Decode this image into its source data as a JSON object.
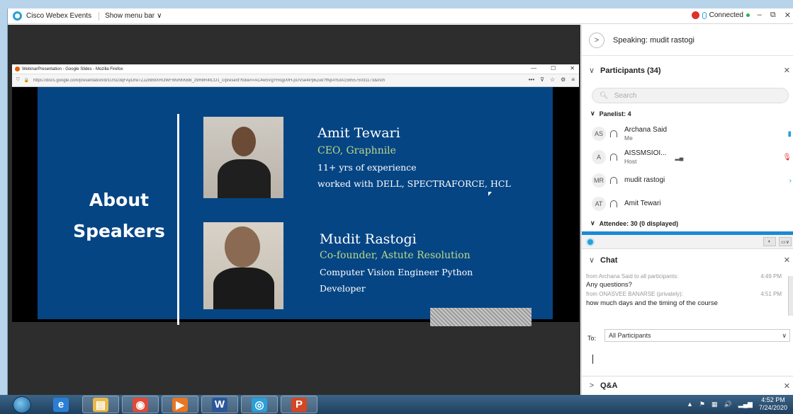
{
  "titlebar": {
    "app_title": "Cisco Webex Events",
    "menu_toggle": "Show menu bar",
    "menu_chevron": "∨",
    "status": "Connected",
    "minimize": "–",
    "restore": "⧉",
    "close": "✕"
  },
  "browser": {
    "tab_title": "WebinarPresentation - Google Slides - Mozilla Firefox",
    "minimize": "—",
    "restore": "☐",
    "close": "✕",
    "url": "https://docs.google.com/presentation/d/1USD3qFAyDrw7ZJZBB9XROWFWvhKKBB_z9R8R4tCO1_c/present?token=AC4w5VgYRogiXfH-pUVse4Pp6Zuk?fNjIA%3A1595575031173&inch",
    "more": "•••",
    "pocket": "⊽",
    "star": "☆",
    "ext": "⚙",
    "menu": "≡"
  },
  "slide": {
    "heading": "About Speakers",
    "speaker1": {
      "name": "Amit Tewari",
      "role": "CEO, Graphnile",
      "line1": "11+ yrs of experience",
      "line2": "worked with DELL, SPECTRAFORCE, HCL"
    },
    "speaker2": {
      "name": "Mudit Rastogi",
      "role": "Co-founder, Astute Resolution",
      "line1": "Computer Vision Engineer Python",
      "line2": "Developer"
    }
  },
  "panel": {
    "speaking_btn": ">",
    "speaking": "Speaking: mudit rastogi",
    "participants_head": "Participants (34)",
    "collapse_chev": "∨",
    "close": "✕",
    "search_placeholder": "Search",
    "panelists_head": "Panelist: 4",
    "participants": [
      {
        "initials": "AS",
        "name": "Archana Said",
        "role": "Me",
        "mark": "▮"
      },
      {
        "initials": "A",
        "name": "AISSMSIOI...",
        "role": "Host",
        "mark": "🎙"
      },
      {
        "initials": "MR",
        "name": "mudit rastogi",
        "role": "",
        "mark": "›"
      },
      {
        "initials": "AT",
        "name": "Amit Tewari",
        "role": "",
        "mark": ""
      }
    ],
    "attendee_head": "Attendee: 30 (0 displayed)",
    "tool_btn1": "◐",
    "tool_btn2": "▭∨",
    "chat_head": "Chat",
    "chat": [
      {
        "meta": "from Archana Said to all participants:",
        "time": "4:49 PM",
        "msg": "Any questions?"
      },
      {
        "meta": "from ONASVEE BANARSE (privately):",
        "time": "4:51 PM",
        "msg": "how much days and the timing of the course"
      }
    ],
    "to_label": "To:",
    "to_value": "All Participants",
    "to_chev": "∨",
    "qa_chev": ">",
    "qa_head": "Q&A"
  },
  "taskbar": {
    "clock_time": "4:52 PM",
    "clock_date": "7/24/2020",
    "tray_up": "▲",
    "tray_flag": "⚑",
    "tray_net": "▦",
    "tray_vol": "🔊",
    "tray_sig": "▂▄▆",
    "items": [
      {
        "glyph": "e",
        "color": "#2a7fd4"
      },
      {
        "glyph": "▤",
        "color": "#e8b94a"
      },
      {
        "glyph": "◉",
        "color": "#dd4b39"
      },
      {
        "glyph": "▶",
        "color": "#e87722"
      },
      {
        "glyph": "W",
        "color": "#2b579a"
      },
      {
        "glyph": "◎",
        "color": "#2a9fd8"
      },
      {
        "glyph": "P",
        "color": "#d24726"
      }
    ]
  }
}
